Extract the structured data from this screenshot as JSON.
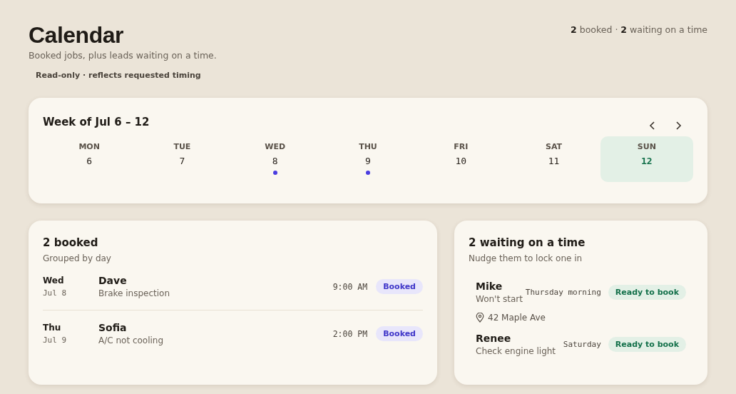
{
  "header": {
    "title": "Calendar",
    "subtitle": "Booked jobs, plus leads waiting on a time.",
    "note": "Read-only · reflects requested timing",
    "summary": "**2** booked · **2** waiting on a time"
  },
  "week": {
    "title": "Week of Jul 6 – 12",
    "days": [
      {
        "name": "MON",
        "date": "6",
        "has_jobs": false,
        "selected": false
      },
      {
        "name": "TUE",
        "date": "7",
        "has_jobs": false,
        "selected": false
      },
      {
        "name": "WED",
        "date": "8",
        "has_jobs": true,
        "selected": false
      },
      {
        "name": "THU",
        "date": "9",
        "has_jobs": true,
        "selected": false
      },
      {
        "name": "FRI",
        "date": "10",
        "has_jobs": false,
        "selected": false
      },
      {
        "name": "SAT",
        "date": "11",
        "has_jobs": false,
        "selected": false
      },
      {
        "name": "SUN",
        "date": "12",
        "has_jobs": false,
        "selected": true
      }
    ]
  },
  "booked": {
    "title": "2 booked",
    "subtitle": "Grouped by day",
    "jobs": [
      {
        "day": "Wed",
        "date": "Jul 8",
        "customer": "Dave",
        "service": "Brake inspection",
        "time": "9:00 AM",
        "status": "Booked",
        "kind": "booked"
      },
      {
        "day": "Thu",
        "date": "Jul 9",
        "customer": "Sofia",
        "service": "A/C not cooling",
        "time": "2:00 PM",
        "status": "Booked",
        "kind": "booked"
      }
    ]
  },
  "waiting": {
    "title": "2 waiting on a time",
    "subtitle": "Nudge them to lock one in",
    "leads": [
      {
        "customer": "Mike",
        "issue": "Won't start",
        "requested": "Thursday morning",
        "status": "Ready to book",
        "kind": "ready",
        "location": "42 Maple Ave"
      },
      {
        "customer": "Renee",
        "issue": "Check engine light",
        "requested": "Saturday",
        "status": "Ready to book",
        "kind": "ready"
      }
    ]
  }
}
